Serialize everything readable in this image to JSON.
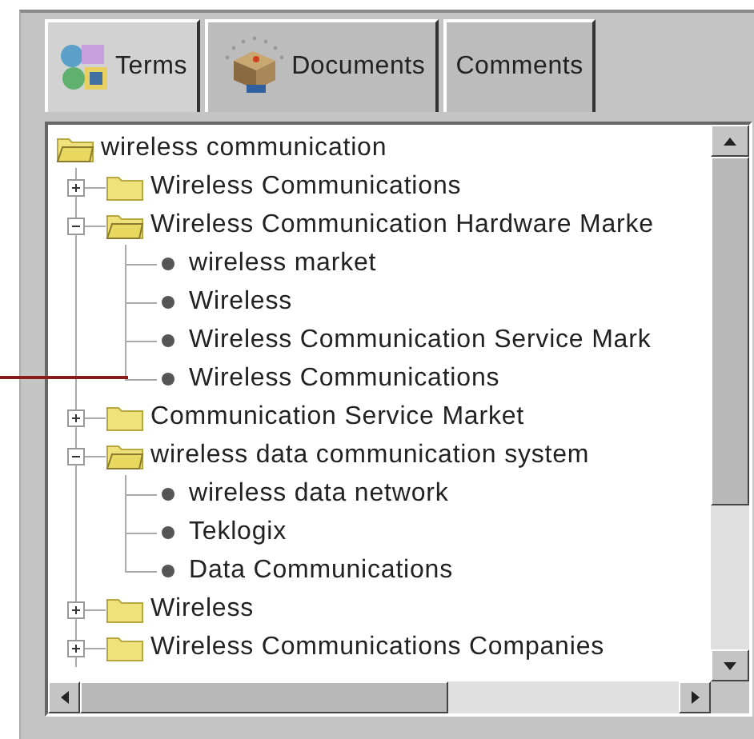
{
  "tabs": [
    {
      "label": "Terms",
      "selected": true,
      "kind": "terms"
    },
    {
      "label": "Documents",
      "selected": false,
      "kind": "documents"
    },
    {
      "label": "Comments",
      "selected": false,
      "kind": "text"
    }
  ],
  "tree": {
    "label": "wireless communication",
    "kind": "folder",
    "expanded": true,
    "children": [
      {
        "label": "Wireless Communications",
        "kind": "folder",
        "expanded": false
      },
      {
        "label": "Wireless Communication Hardware Marke",
        "kind": "folder",
        "expanded": true,
        "children": [
          {
            "label": "wireless market",
            "kind": "leaf"
          },
          {
            "label": "Wireless",
            "kind": "leaf"
          },
          {
            "label": "Wireless Communication Service Mark",
            "kind": "leaf"
          },
          {
            "label": "Wireless Communications",
            "kind": "leaf"
          }
        ]
      },
      {
        "label": "Communication Service Market",
        "kind": "folder",
        "expanded": false
      },
      {
        "label": "wireless data communication system",
        "kind": "folder",
        "expanded": true,
        "children": [
          {
            "label": "wireless data network",
            "kind": "leaf"
          },
          {
            "label": "Teklogix",
            "kind": "leaf"
          },
          {
            "label": "Data Communications",
            "kind": "leaf"
          }
        ]
      },
      {
        "label": "Wireless",
        "kind": "folder",
        "expanded": false
      },
      {
        "label": "Wireless Communications Companies",
        "kind": "folder",
        "expanded": false
      }
    ]
  }
}
